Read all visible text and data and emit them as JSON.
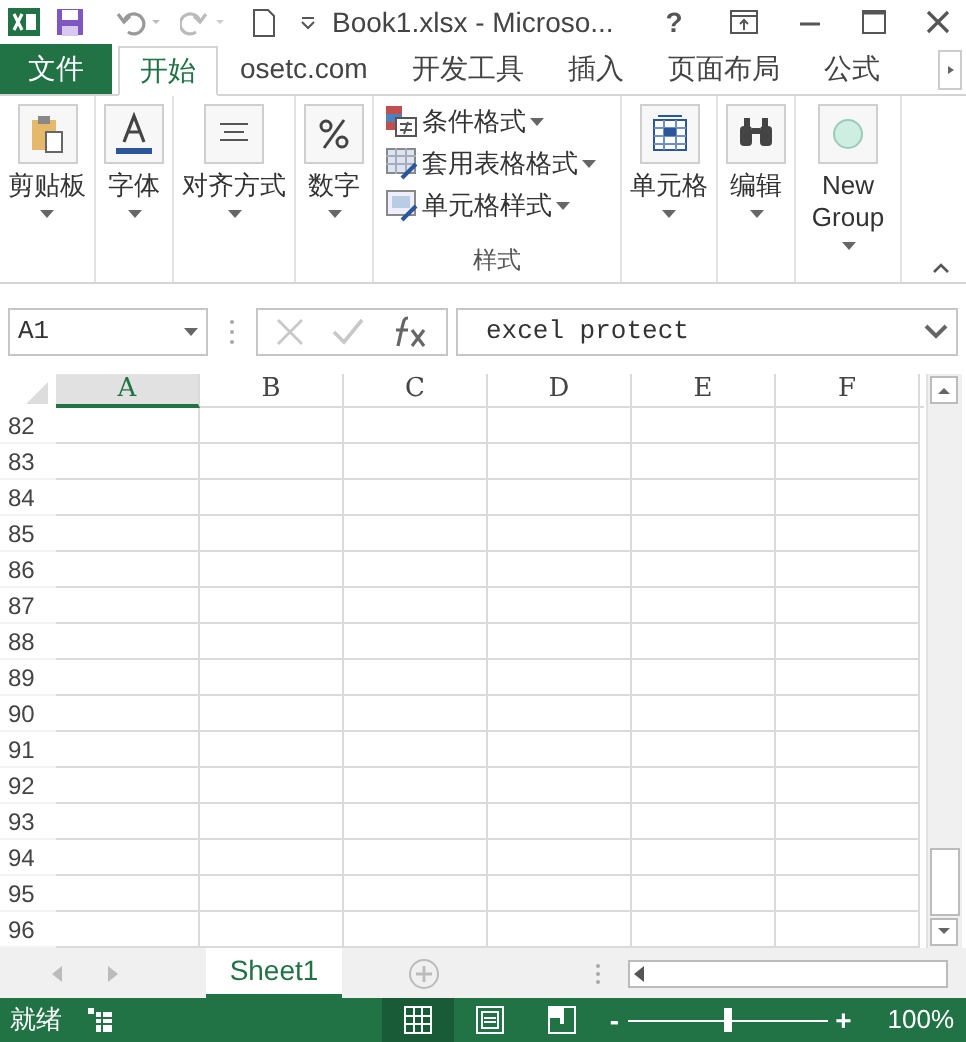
{
  "window": {
    "title": "Book1.xlsx - Microso...",
    "help": "?"
  },
  "tabs": [
    {
      "label": "文件",
      "kind": "file",
      "selected": false
    },
    {
      "label": "开始",
      "kind": "tab",
      "selected": true
    },
    {
      "label": "osetc.com",
      "kind": "tab",
      "selected": false
    },
    {
      "label": "开发工具",
      "kind": "tab",
      "selected": false
    },
    {
      "label": "插入",
      "kind": "tab",
      "selected": false
    },
    {
      "label": "页面布局",
      "kind": "tab",
      "selected": false
    },
    {
      "label": "公式",
      "kind": "tab",
      "selected": false
    }
  ],
  "ribbon": {
    "groups": [
      {
        "kind": "big",
        "label": "剪贴板"
      },
      {
        "kind": "big",
        "label": "字体"
      },
      {
        "kind": "big",
        "label": "对齐方式"
      },
      {
        "kind": "big",
        "label": "数字"
      },
      {
        "kind": "styles",
        "label": "样式",
        "items": [
          "条件格式",
          "套用表格格式",
          "单元格样式"
        ]
      },
      {
        "kind": "big",
        "label": "单元格"
      },
      {
        "kind": "big",
        "label": "编辑"
      },
      {
        "kind": "big",
        "label": "New Group"
      }
    ]
  },
  "formula_bar": {
    "name_box": "A1",
    "formula": "excel protect"
  },
  "columns": [
    {
      "label": "A",
      "selected": true
    },
    {
      "label": "B",
      "selected": false
    },
    {
      "label": "C",
      "selected": false
    },
    {
      "label": "D",
      "selected": false
    },
    {
      "label": "E",
      "selected": false
    },
    {
      "label": "F",
      "selected": false
    }
  ],
  "rows": [
    "82",
    "83",
    "84",
    "85",
    "86",
    "87",
    "88",
    "89",
    "90",
    "91",
    "92",
    "93",
    "94",
    "95",
    "96"
  ],
  "sheets": [
    {
      "label": "Sheet1",
      "selected": true
    }
  ],
  "status_bar": {
    "status": "就绪",
    "views": [
      {
        "kind": "normal",
        "selected": true
      },
      {
        "kind": "layout",
        "selected": false
      },
      {
        "kind": "break",
        "selected": false
      }
    ],
    "zoom_out": "-",
    "zoom_slider": {
      "level": 0.5
    },
    "zoom_in": "+",
    "zoom": "100%"
  }
}
